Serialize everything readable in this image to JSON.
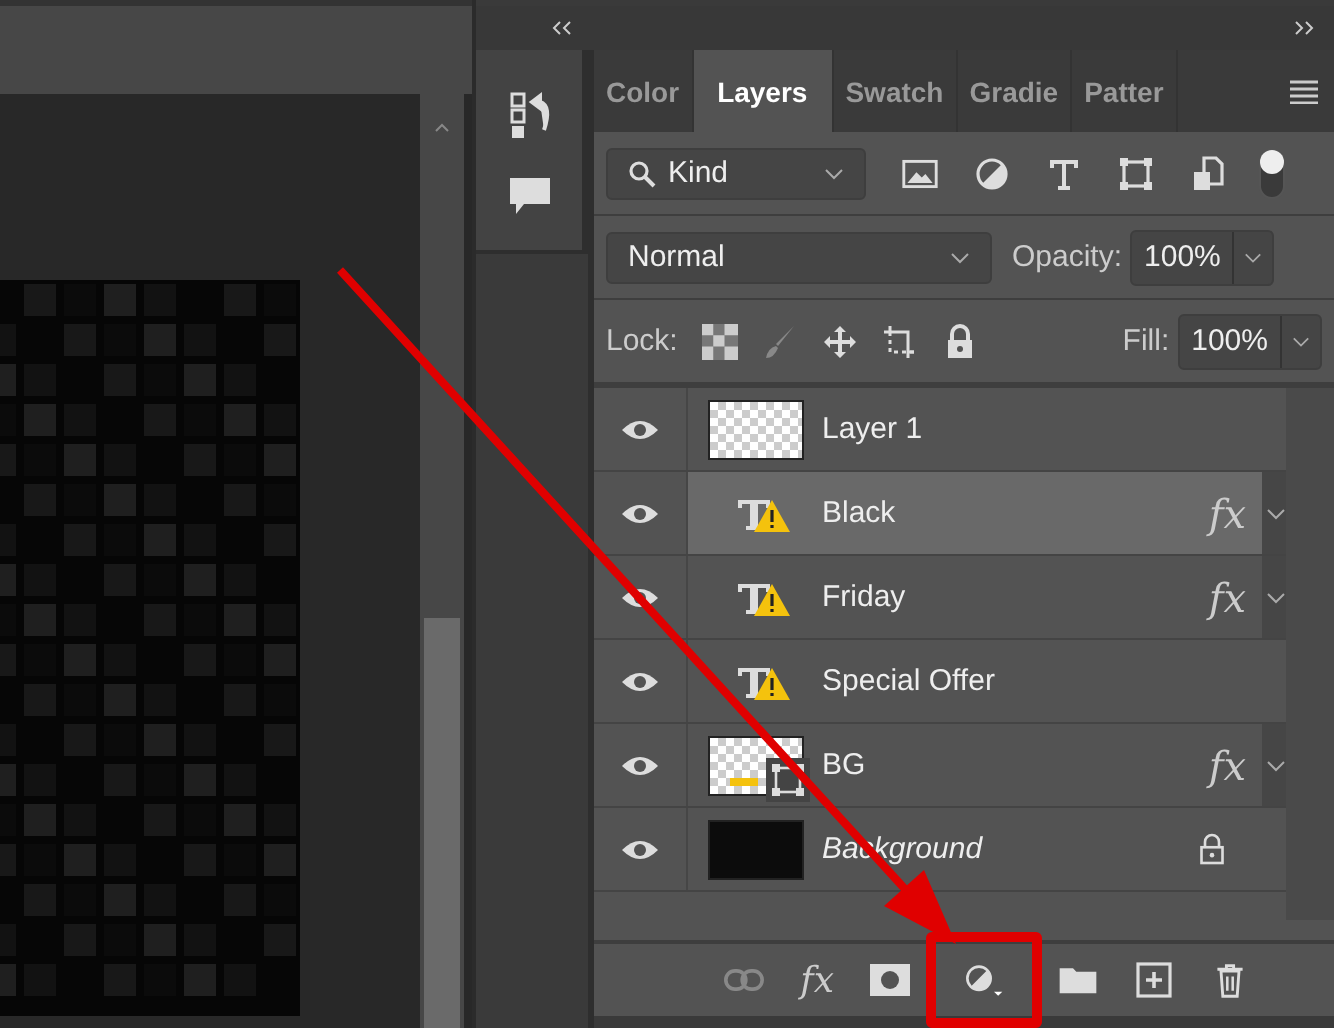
{
  "tabs": [
    {
      "label": "Color",
      "selected": false
    },
    {
      "label": "Layers",
      "selected": true
    },
    {
      "label": "Swatch",
      "selected": false
    },
    {
      "label": "Gradie",
      "selected": false
    },
    {
      "label": "Patter",
      "selected": false
    }
  ],
  "filter": {
    "value": "Kind"
  },
  "blend": {
    "mode": "Normal",
    "opacity_label": "Opacity:",
    "opacity": "100%"
  },
  "lock": {
    "label": "Lock:",
    "fill_label": "Fill:",
    "fill": "100%"
  },
  "layers": [
    {
      "name": "Layer 1",
      "kind": "raster",
      "visible": true,
      "selected": false,
      "locked": false
    },
    {
      "name": "Black",
      "kind": "text",
      "visible": true,
      "selected": true,
      "effects": "fx",
      "locked": false
    },
    {
      "name": "Friday",
      "kind": "text",
      "visible": true,
      "selected": false,
      "effects": "fx",
      "locked": false
    },
    {
      "name": "Special Offer",
      "kind": "text",
      "visible": true,
      "selected": false,
      "locked": false
    },
    {
      "name": "BG",
      "kind": "smart",
      "visible": true,
      "selected": false,
      "effects": "fx",
      "locked": false
    },
    {
      "name": "Background",
      "kind": "background",
      "visible": true,
      "selected": false,
      "locked": true
    }
  ],
  "bottom_bar": {
    "fx_label": "fx",
    "adjustment_highlighted": true
  }
}
